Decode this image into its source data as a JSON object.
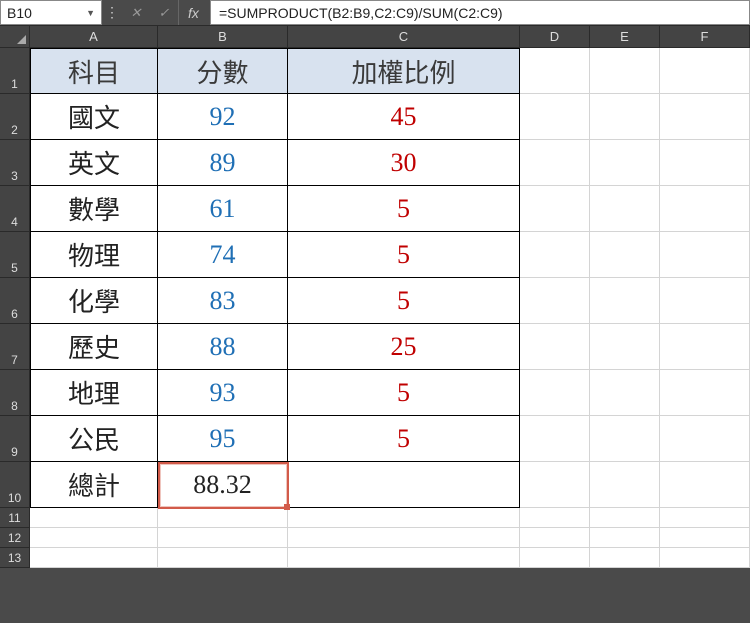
{
  "name_box": "B10",
  "fx_label": "fx",
  "formula": "=SUMPRODUCT(B2:B9,C2:C9)/SUM(C2:C9)",
  "col_labels": [
    "A",
    "B",
    "C",
    "D",
    "E",
    "F"
  ],
  "row_labels": [
    "1",
    "2",
    "3",
    "4",
    "5",
    "6",
    "7",
    "8",
    "9",
    "10",
    "11",
    "12",
    "13"
  ],
  "headers": {
    "subject": "科目",
    "score": "分數",
    "weight": "加權比例"
  },
  "rows": [
    {
      "subject": "國文",
      "score": "92",
      "weight": "45"
    },
    {
      "subject": "英文",
      "score": "89",
      "weight": "30"
    },
    {
      "subject": "數學",
      "score": "61",
      "weight": "5"
    },
    {
      "subject": "物理",
      "score": "74",
      "weight": "5"
    },
    {
      "subject": "化學",
      "score": "83",
      "weight": "5"
    },
    {
      "subject": "歷史",
      "score": "88",
      "weight": "25"
    },
    {
      "subject": "地理",
      "score": "93",
      "weight": "5"
    },
    {
      "subject": "公民",
      "score": "95",
      "weight": "5"
    }
  ],
  "total": {
    "label": "總計",
    "value": "88.32"
  },
  "chart_data": {
    "type": "table",
    "title": "",
    "columns": [
      "科目",
      "分數",
      "加權比例"
    ],
    "data": [
      [
        "國文",
        92,
        45
      ],
      [
        "英文",
        89,
        30
      ],
      [
        "數學",
        61,
        5
      ],
      [
        "物理",
        74,
        5
      ],
      [
        "化學",
        83,
        5
      ],
      [
        "歷史",
        88,
        25
      ],
      [
        "地理",
        93,
        5
      ],
      [
        "公民",
        95,
        5
      ]
    ],
    "weighted_average": 88.32
  }
}
